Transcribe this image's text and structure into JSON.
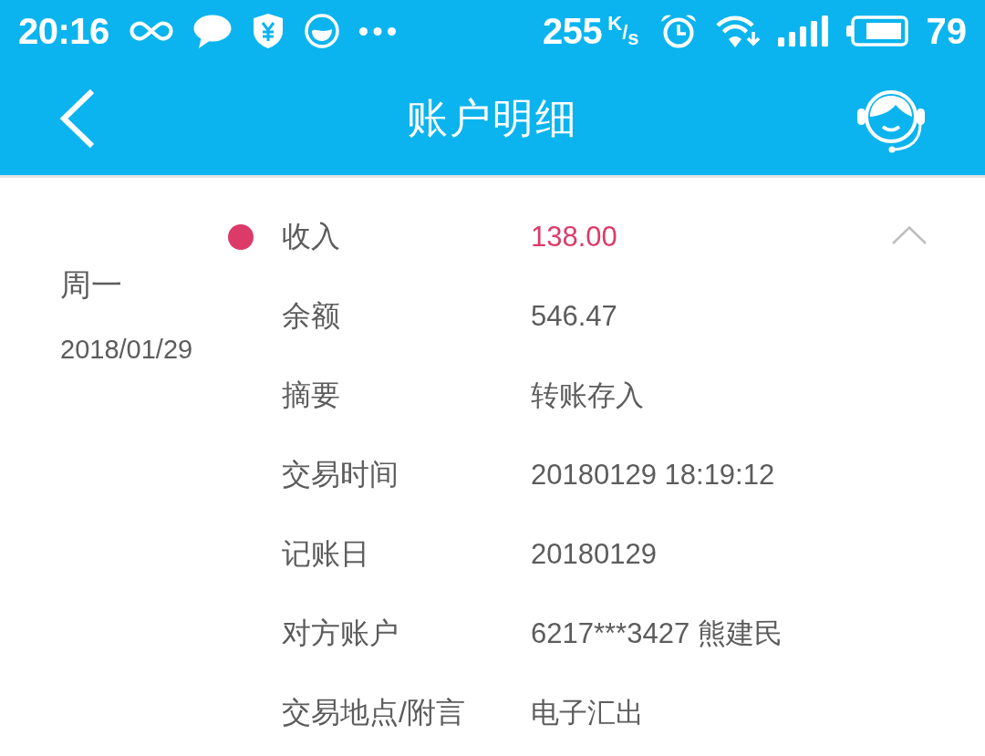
{
  "status_bar": {
    "time": "20:16",
    "net_speed": "255",
    "net_unit": "$^{K}$/$_{s}$",
    "battery": "79"
  },
  "header": {
    "title": "账户明细"
  },
  "transaction": {
    "weekday": "周一",
    "date": "2018/01/29",
    "color": "#dc3a68",
    "expanded": true,
    "fields": [
      {
        "kind": "amount",
        "label": "收入",
        "value": "138.00"
      },
      {
        "kind": "detail",
        "label": "余额",
        "value": "546.47"
      },
      {
        "kind": "detail",
        "label": "摘要",
        "value": "转账存入"
      },
      {
        "kind": "detail",
        "label": "交易时间",
        "value": "20180129 18:19:12"
      },
      {
        "kind": "detail",
        "label": "记账日",
        "value": "20180129"
      },
      {
        "kind": "detail",
        "label": "对方账户",
        "value": "6217***3427 熊建民"
      },
      {
        "kind": "detail",
        "label": "交易地点/附言",
        "value": "电子汇出"
      }
    ]
  }
}
